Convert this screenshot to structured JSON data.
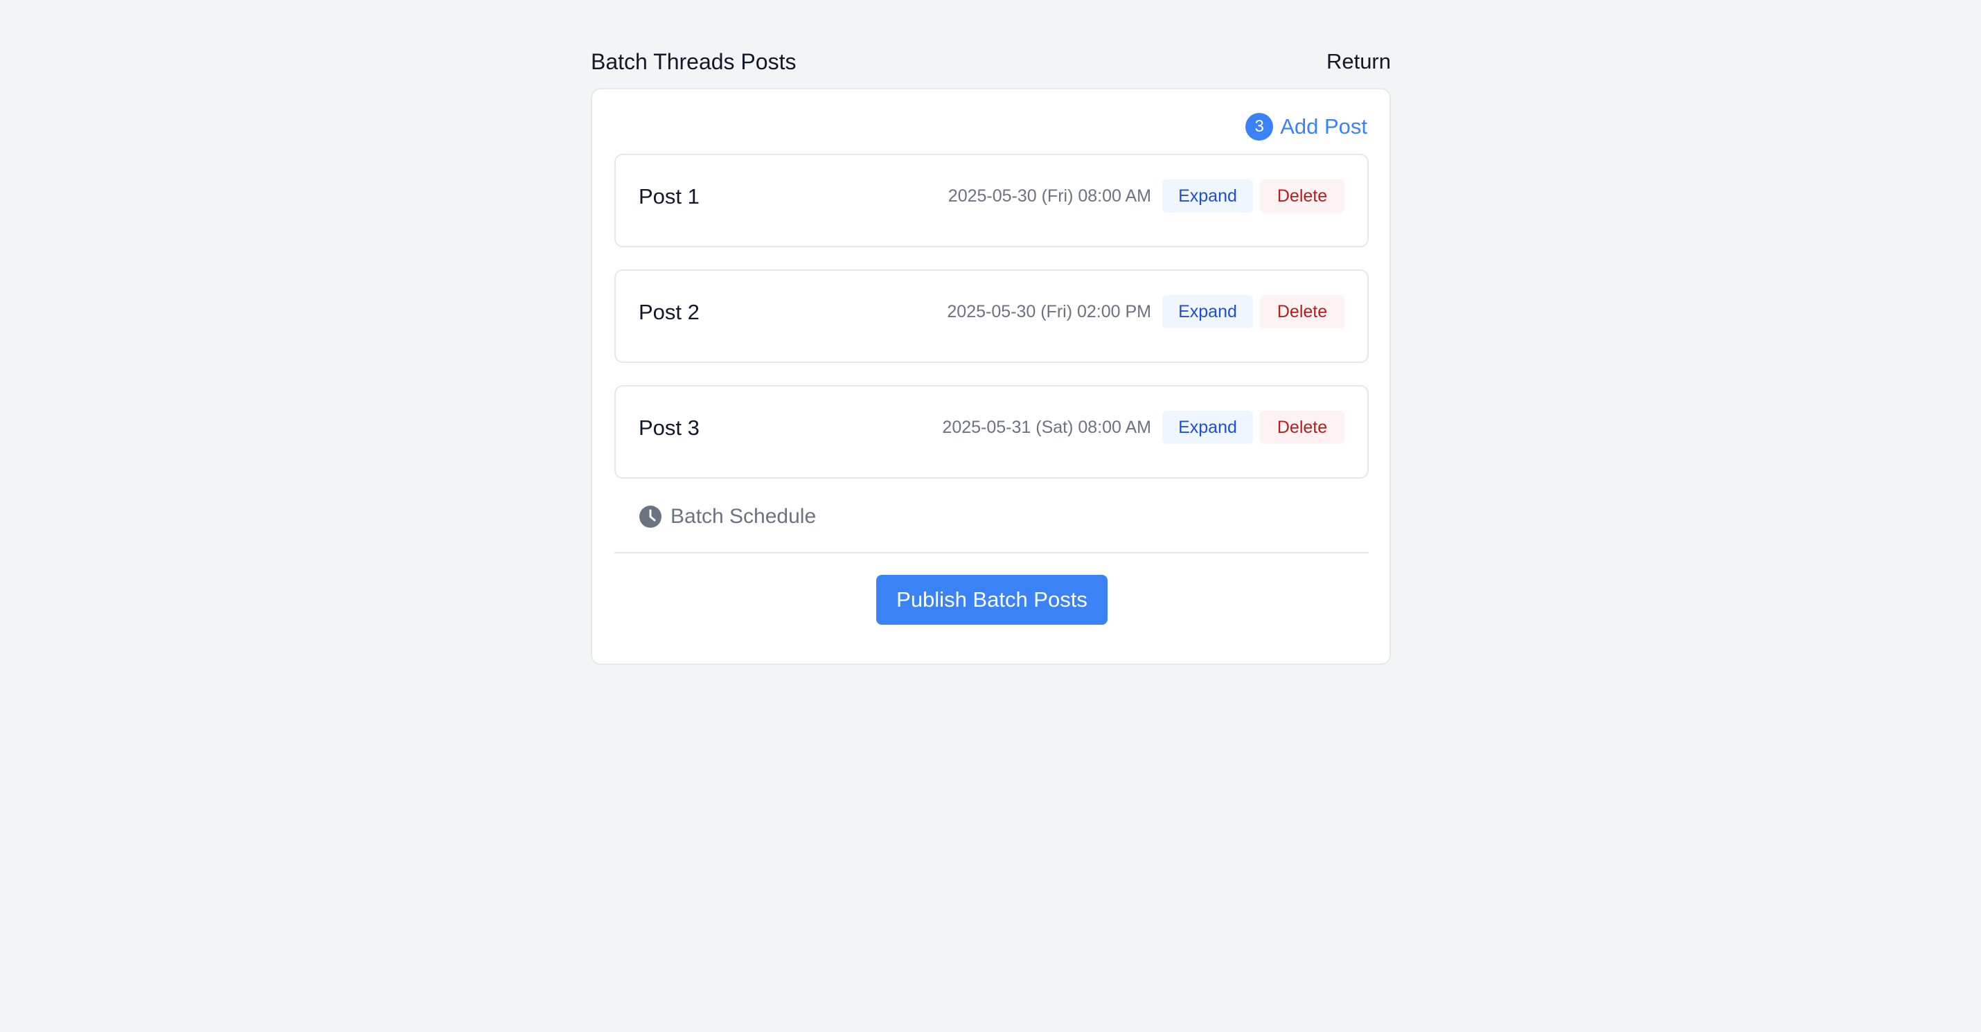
{
  "header": {
    "title": "Batch Threads Posts",
    "return_label": "Return"
  },
  "card": {
    "add_post": {
      "count": "3",
      "label": "Add Post"
    },
    "posts": [
      {
        "title": "Post 1",
        "time": "2025-05-30 (Fri) 08:00 AM",
        "expand_label": "Expand",
        "delete_label": "Delete"
      },
      {
        "title": "Post 2",
        "time": "2025-05-30 (Fri) 02:00 PM",
        "expand_label": "Expand",
        "delete_label": "Delete"
      },
      {
        "title": "Post 3",
        "time": "2025-05-31 (Sat) 08:00 AM",
        "expand_label": "Expand",
        "delete_label": "Delete"
      }
    ],
    "batch_schedule": {
      "label": "Batch Schedule",
      "icon": "clock-icon"
    },
    "publish_label": "Publish Batch Posts"
  },
  "colors": {
    "background": "#f3f4f6",
    "accent": "#3b82f6",
    "expand_bg": "#eff6ff",
    "expand_text": "#1d4ed8",
    "delete_bg": "#fef2f2",
    "delete_text": "#b91c1c",
    "muted_text": "#6b7280"
  }
}
